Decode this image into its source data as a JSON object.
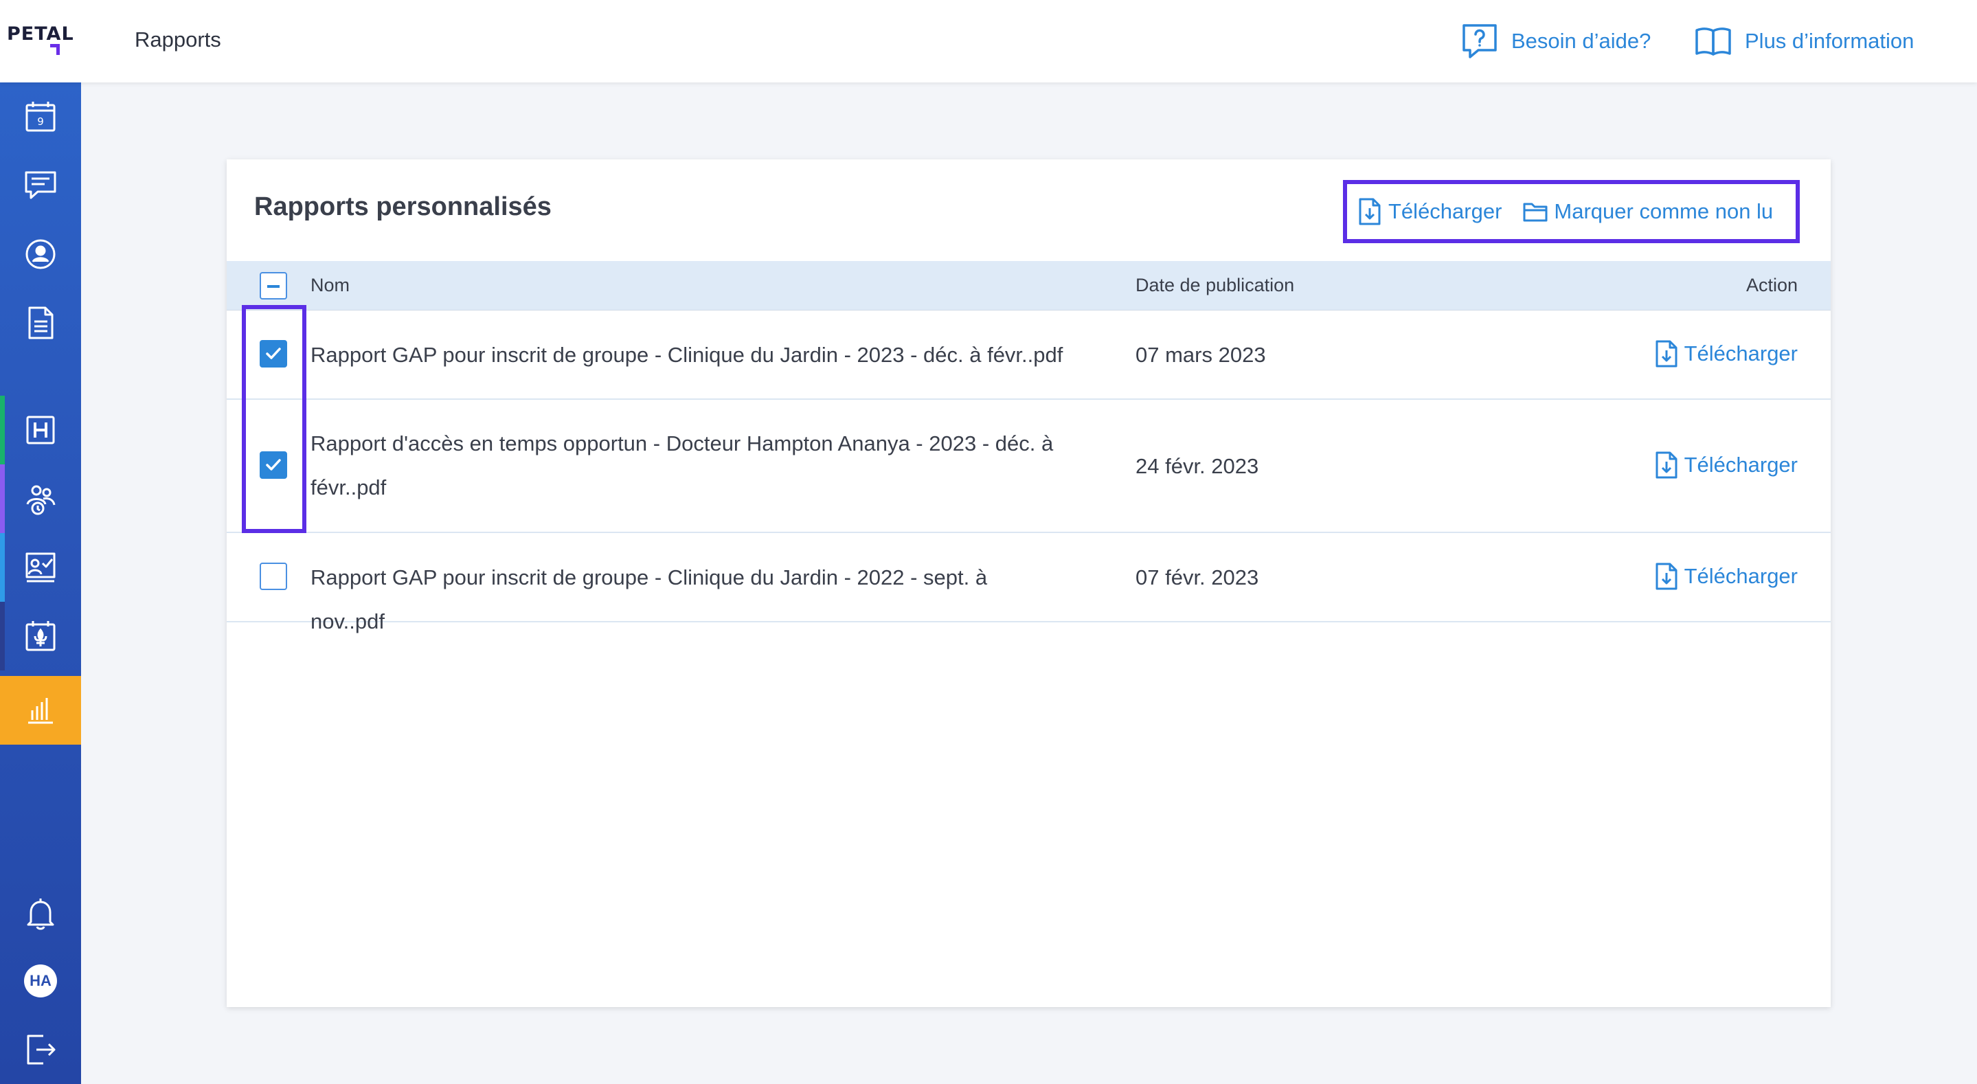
{
  "app": {
    "logo_text": "PETAL",
    "page_title": "Rapports"
  },
  "header": {
    "help_label": "Besoin d’aide?",
    "info_label": "Plus d’information"
  },
  "sidebar": {
    "calendar_day": "9",
    "avatar_initials": "HA",
    "accent_colors": [
      "#19b26b",
      "#8a5cf0",
      "#2f9be8",
      "#2a3f91"
    ],
    "active_color": "#f7a823"
  },
  "card": {
    "title": "Rapports personnalisés",
    "bulk_download_label": "Télécharger",
    "bulk_mark_unread_label": "Marquer comme non lu"
  },
  "table": {
    "columns": {
      "name": "Nom",
      "date": "Date de publication",
      "action": "Action"
    },
    "rows": [
      {
        "name": "Rapport GAP pour inscrit de groupe - Clinique du Jardin - 2023 - déc. à févr..pdf",
        "date": "07 mars 2023",
        "action": "Télécharger",
        "checked": true
      },
      {
        "name": "Rapport d'accès en temps opportun - Docteur Hampton Ananya - 2023 - déc. à févr..pdf",
        "date": "24 févr. 2023",
        "action": "Télécharger",
        "checked": true
      },
      {
        "name": "Rapport GAP pour inscrit de groupe - Clinique du Jardin - 2022 - sept. à nov..pdf",
        "date": "07 févr. 2023",
        "action": "Télécharger",
        "checked": false
      }
    ]
  }
}
